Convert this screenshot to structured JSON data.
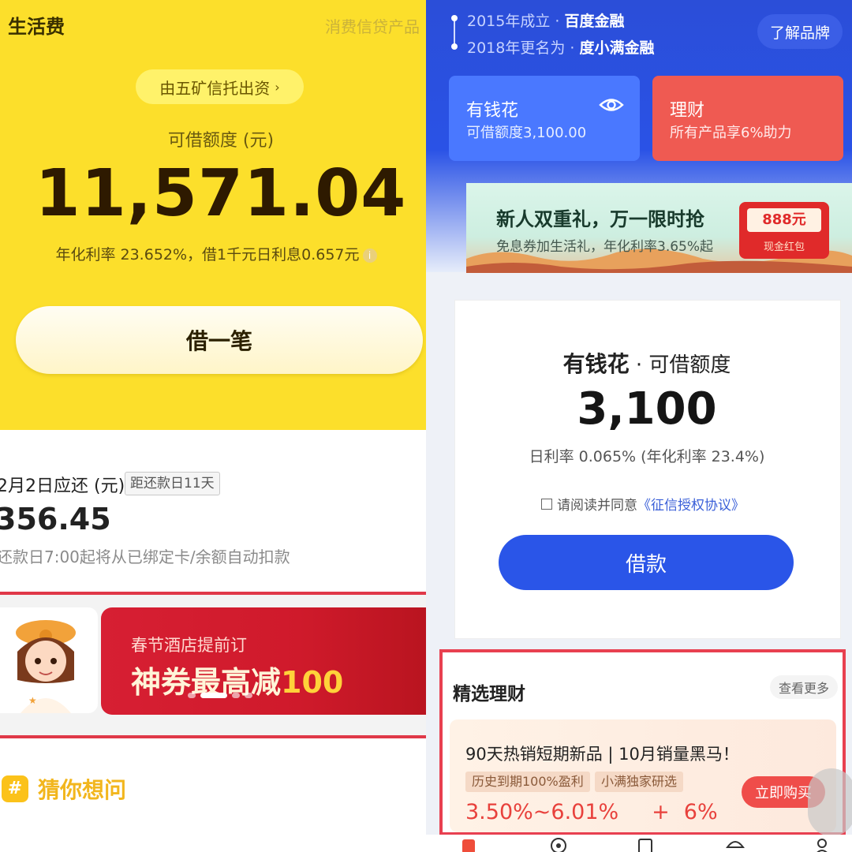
{
  "left": {
    "title": "生活费",
    "top_right_text": "消费信贷产品",
    "trust_pill": "由五矿信托出资",
    "limit_label": "可借额度 (元)",
    "limit_amount": "11,571.04",
    "rate_text": "年化利率 23.652%，借1千元日利息0.657元",
    "borrow_button": "借一笔",
    "repay_date": "2月2日应还 (元)",
    "due_badge": "距还款日11天",
    "repay_amount": "356.45",
    "repay_note": "还款日7:00起将从已绑定卡/余额自动扣款",
    "banner_sub": "春节酒店提前订",
    "banner_main": "神券最高减",
    "banner_num": "100",
    "guess_label": "猜你想问"
  },
  "right": {
    "timeline_1_prefix": "2015年成立 · ",
    "timeline_1_bold": "百度金融",
    "timeline_2_prefix": "2018年更名为 · ",
    "timeline_2_bold": "度小满金融",
    "brand_button": "了解品牌",
    "card_ygh_title": "有钱花",
    "card_ygh_sub": "可借额度3,100.00",
    "card_lc_title": "理财",
    "card_lc_sub": "所有产品享6%助力",
    "promo_title": "新人双重礼，万一限时抢",
    "promo_sub": "免息券加生活礼，年化利率3.65%起",
    "promo_env_amount": "888元",
    "promo_env_label": "现金红包",
    "loan_title_bold": "有钱花",
    "loan_title_rest": " · 可借额度",
    "loan_amount": "3,100",
    "loan_rate": "日利率 0.065% (年化利率 23.4%)",
    "agree_text": "请阅读并同意",
    "agree_link": "《征信授权协议》",
    "loan_button": "借款",
    "fin_title": "精选理财",
    "fin_more": "查看更多",
    "prod_title": "90天热销短期新品 | 10月销量黑马！",
    "tag_1": "历史到期100%盈利",
    "tag_2": "小满独家研选",
    "buy_button": "立即购买",
    "prod_rate_range": "3.50%~6.01%",
    "prod_rate_plus": "+",
    "prod_rate_bonus": "6%"
  },
  "colors": {
    "left_yellow": "#fcdf2b",
    "right_blue": "#2a52e6",
    "highlight_red": "#e84050"
  }
}
